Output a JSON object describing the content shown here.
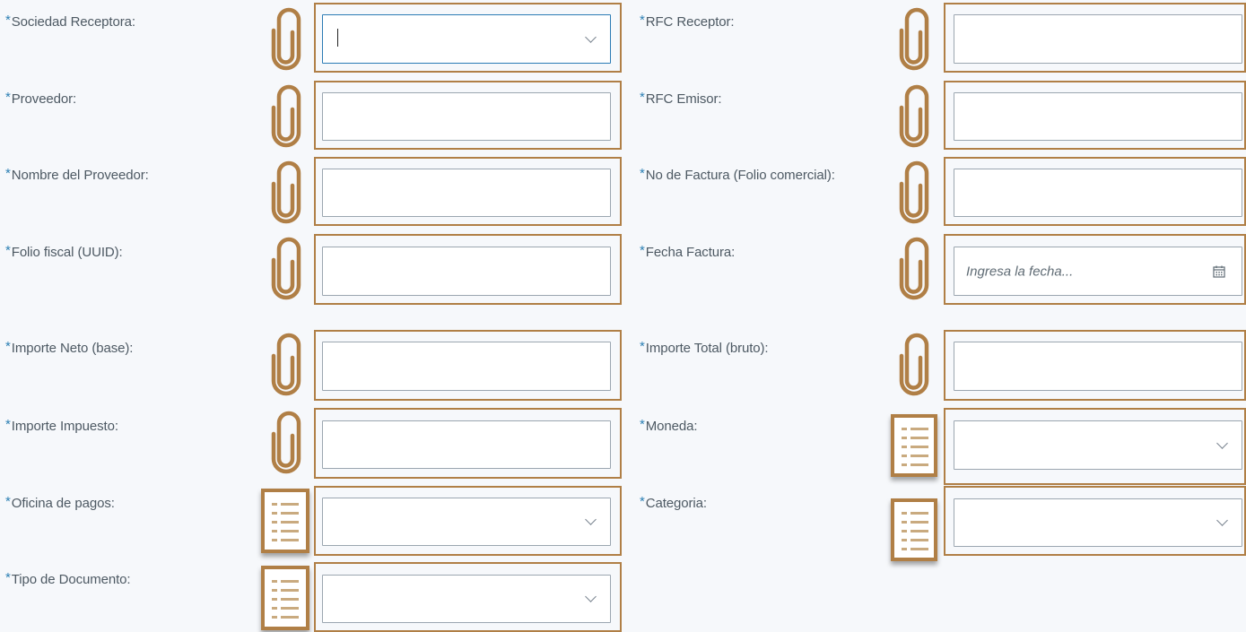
{
  "required_marker": "*",
  "left_fields": [
    {
      "label": "Sociedad Receptora:",
      "type": "select",
      "value": "",
      "focused": true,
      "icon": "paperclip-icon"
    },
    {
      "label": "Proveedor:",
      "type": "text",
      "value": "",
      "icon": "paperclip-icon"
    },
    {
      "label": "Nombre del Proveedor:",
      "type": "text",
      "value": "",
      "icon": "paperclip-icon"
    },
    {
      "label": "Folio fiscal (UUID):",
      "type": "text",
      "value": "",
      "icon": "paperclip-icon"
    },
    {
      "label": "Importe Neto (base):",
      "type": "text",
      "value": "",
      "icon": "paperclip-icon"
    },
    {
      "label": "Importe Impuesto:",
      "type": "text",
      "value": "",
      "icon": "paperclip-icon"
    },
    {
      "label": "Oficina de pagos:",
      "type": "select",
      "value": "",
      "icon": "list-icon"
    },
    {
      "label": "Tipo de Documento:",
      "type": "select",
      "value": "",
      "icon": "list-icon"
    }
  ],
  "right_fields": [
    {
      "label": "RFC Receptor:",
      "type": "text",
      "value": "",
      "icon": "paperclip-icon"
    },
    {
      "label": "RFC Emisor:",
      "type": "text",
      "value": "",
      "icon": "paperclip-icon"
    },
    {
      "label": "No de Factura (Folio comercial):",
      "type": "text",
      "value": "",
      "icon": "paperclip-icon"
    },
    {
      "label": "Fecha Factura:",
      "type": "date",
      "placeholder": "Ingresa la fecha...",
      "icon": "paperclip-icon"
    },
    {
      "label": "Importe Total (bruto):",
      "type": "text",
      "value": "",
      "icon": "paperclip-icon"
    },
    {
      "label": "Moneda:",
      "type": "select",
      "value": "",
      "icon": "list-icon"
    },
    {
      "label": "Categoria:",
      "type": "select",
      "value": "",
      "icon": "list-icon"
    }
  ],
  "colors": {
    "accent": "#b07f46",
    "required": "#2d80b4",
    "focus": "#2b7bb5",
    "background": "#f6f8fb"
  }
}
